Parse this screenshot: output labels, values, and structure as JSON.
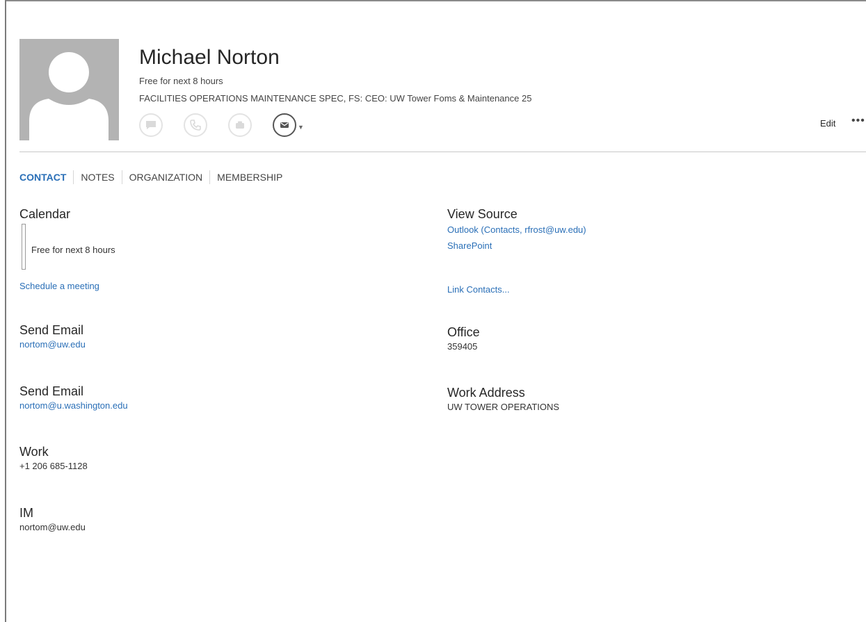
{
  "contact": {
    "name": "Michael Norton",
    "status": "Free for next 8 hours",
    "title": "FACILITIES OPERATIONS MAINTENANCE SPEC, FS: CEO: UW Tower Foms & Maintenance 25"
  },
  "header": {
    "icons": [
      "chat-bubble-icon",
      "phone-icon",
      "video-icon",
      "mail-icon"
    ],
    "edit_label": "Edit",
    "more_label": "•••"
  },
  "tabs": [
    {
      "label": "CONTACT",
      "active": true
    },
    {
      "label": "NOTES",
      "active": false
    },
    {
      "label": "ORGANIZATION",
      "active": false
    },
    {
      "label": "MEMBERSHIP",
      "active": false
    }
  ],
  "left": {
    "calendar": {
      "heading": "Calendar",
      "status": "Free for next 8 hours",
      "schedule_link": "Schedule a meeting"
    },
    "email1": {
      "heading": "Send Email",
      "value": "nortom@uw.edu"
    },
    "email2": {
      "heading": "Send Email",
      "value": "nortom@u.washington.edu"
    },
    "work": {
      "heading": "Work",
      "value": "+1 206 685-1128"
    },
    "im": {
      "heading": "IM",
      "value": "nortom@uw.edu"
    }
  },
  "right": {
    "view_source": {
      "heading": "View Source",
      "outlook_link": "Outlook (Contacts, rfrost@uw.edu)",
      "sharepoint_link": "SharePoint",
      "link_contacts": "Link Contacts..."
    },
    "office": {
      "heading": "Office",
      "value": "359405"
    },
    "work_address": {
      "heading": "Work Address",
      "value": "UW TOWER OPERATIONS"
    }
  },
  "colors": {
    "accent": "#2a6fb7",
    "text": "#262626",
    "avatar_bg": "#b3b3b3"
  }
}
